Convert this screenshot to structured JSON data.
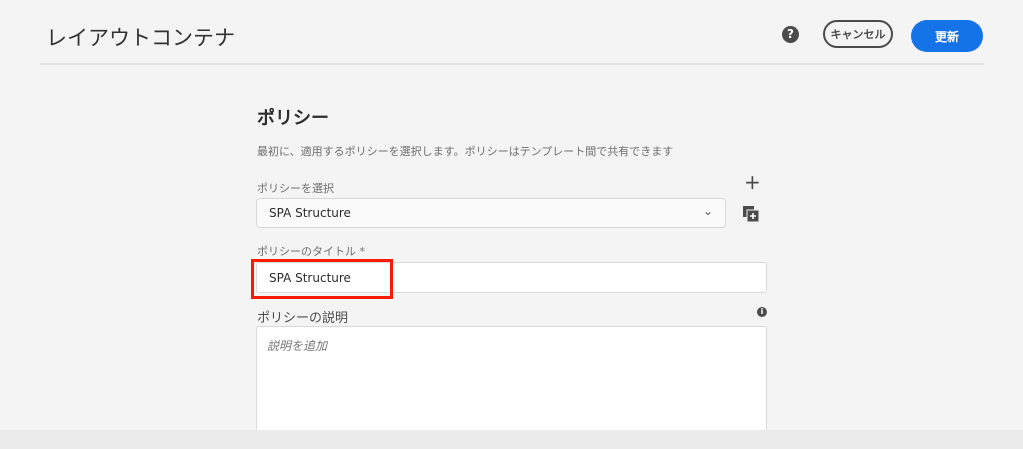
{
  "header": {
    "title": "レイアウトコンテナ",
    "help_icon": "?",
    "cancel_label": "キャンセル",
    "update_label": "更新"
  },
  "policy": {
    "heading": "ポリシー",
    "description": "最初に、適用するポリシーを選択します。ポリシーはテンプレート間で共有できます",
    "select_label": "ポリシーを選択",
    "select_value": "SPA Structure",
    "title_label": "ポリシーのタイトル *",
    "title_value": "SPA Structure",
    "desc_label": "ポリシーの説明",
    "desc_placeholder": "説明を追加"
  },
  "colors": {
    "accent": "#1473e6",
    "highlight": "#fa1b00"
  }
}
